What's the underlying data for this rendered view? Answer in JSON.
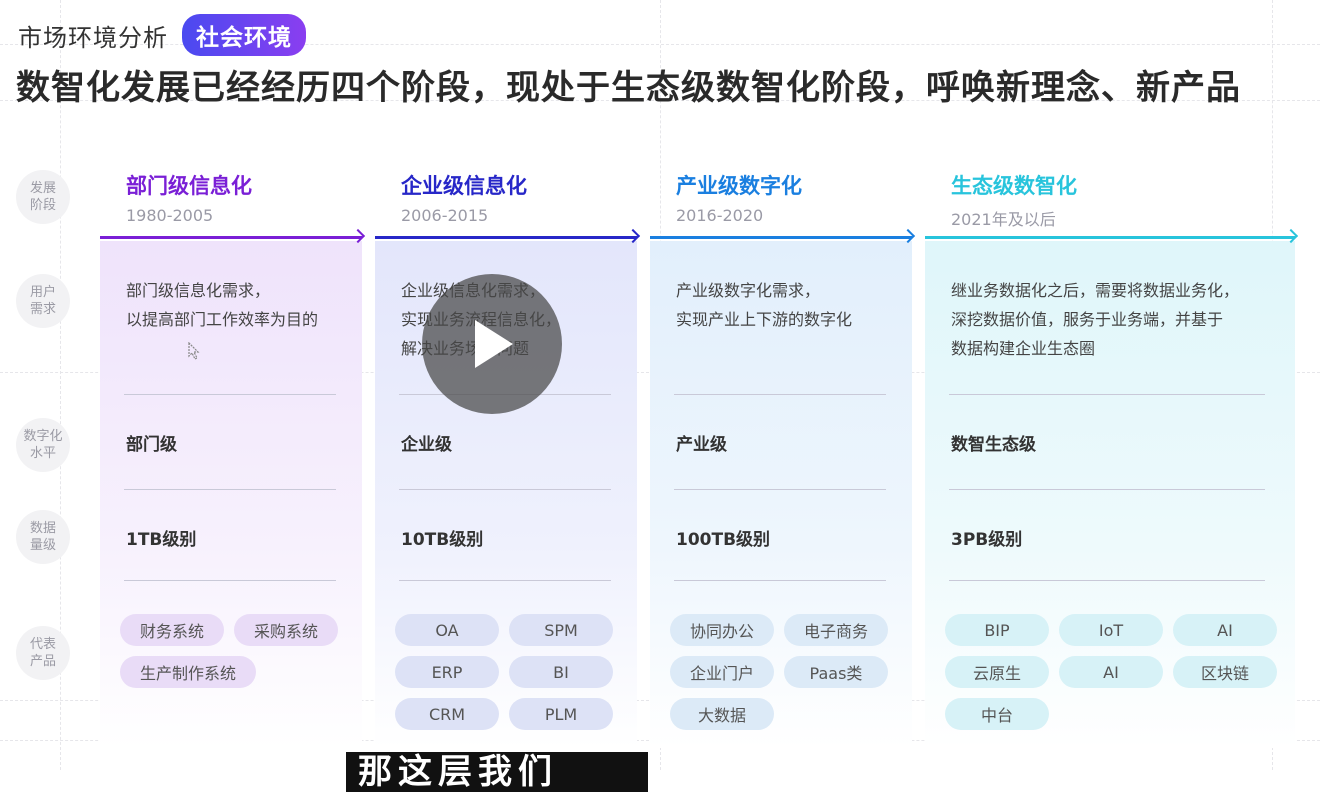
{
  "header": {
    "subtitle": "市场环境分析",
    "tag": "社会环境",
    "headline": "数智化发展已经经历四个阶段，现处于生态级数智化阶段，呼唤新理念、新产品"
  },
  "row_labels": [
    "发展阶段",
    "用户需求",
    "数字化水平",
    "数据量级",
    "代表产品"
  ],
  "row_label_lines": [
    [
      "发展",
      "阶段"
    ],
    [
      "用户",
      "需求"
    ],
    [
      "数字化",
      "水平"
    ],
    [
      "数据",
      "量级"
    ],
    [
      "代表",
      "产品"
    ]
  ],
  "stages": [
    {
      "title": "部门级信息化",
      "years": "1980-2005",
      "color": "#7a1fd6",
      "need": [
        "部门级信息化需求，",
        "以提高部门工作效率为目的"
      ],
      "level": "部门级",
      "volume": "1TB级别",
      "products": [
        "财务系统",
        "采购系统",
        "生产制作系统"
      ]
    },
    {
      "title": "企业级信息化",
      "years": "2006-2015",
      "color": "#2727c8",
      "need": [
        "企业级信息化需求，",
        "实现业务流程信息化，",
        "解决业务场景问题"
      ],
      "level": "企业级",
      "volume": "10TB级别",
      "products": [
        "OA",
        "SPM",
        "ERP",
        "BI",
        "CRM",
        "PLM"
      ]
    },
    {
      "title": "产业级数字化",
      "years": "2016-2020",
      "color": "#1a7fe0",
      "need": [
        "产业级数字化需求，",
        "实现产业上下游的数字化"
      ],
      "level": "产业级",
      "volume": "100TB级别",
      "products": [
        "协同办公",
        "电子商务",
        "企业门户",
        "Paas类",
        "大数据"
      ]
    },
    {
      "title": "生态级数智化",
      "years": "2021年及以后",
      "color": "#28c4dc",
      "need": [
        "继业务数据化之后，需要将数据业务化，",
        "深挖数据价值，服务于业务端，并基于",
        "数据构建企业生态圈"
      ],
      "level": "数智生态级",
      "volume": "3PB级别",
      "products": [
        "BIP",
        "IoT",
        "AI",
        "云原生",
        "AI",
        "区块链",
        "中台"
      ]
    }
  ],
  "caption": "那这层我们",
  "icons": {
    "play": "play-icon",
    "cursor": "cursor-icon"
  }
}
